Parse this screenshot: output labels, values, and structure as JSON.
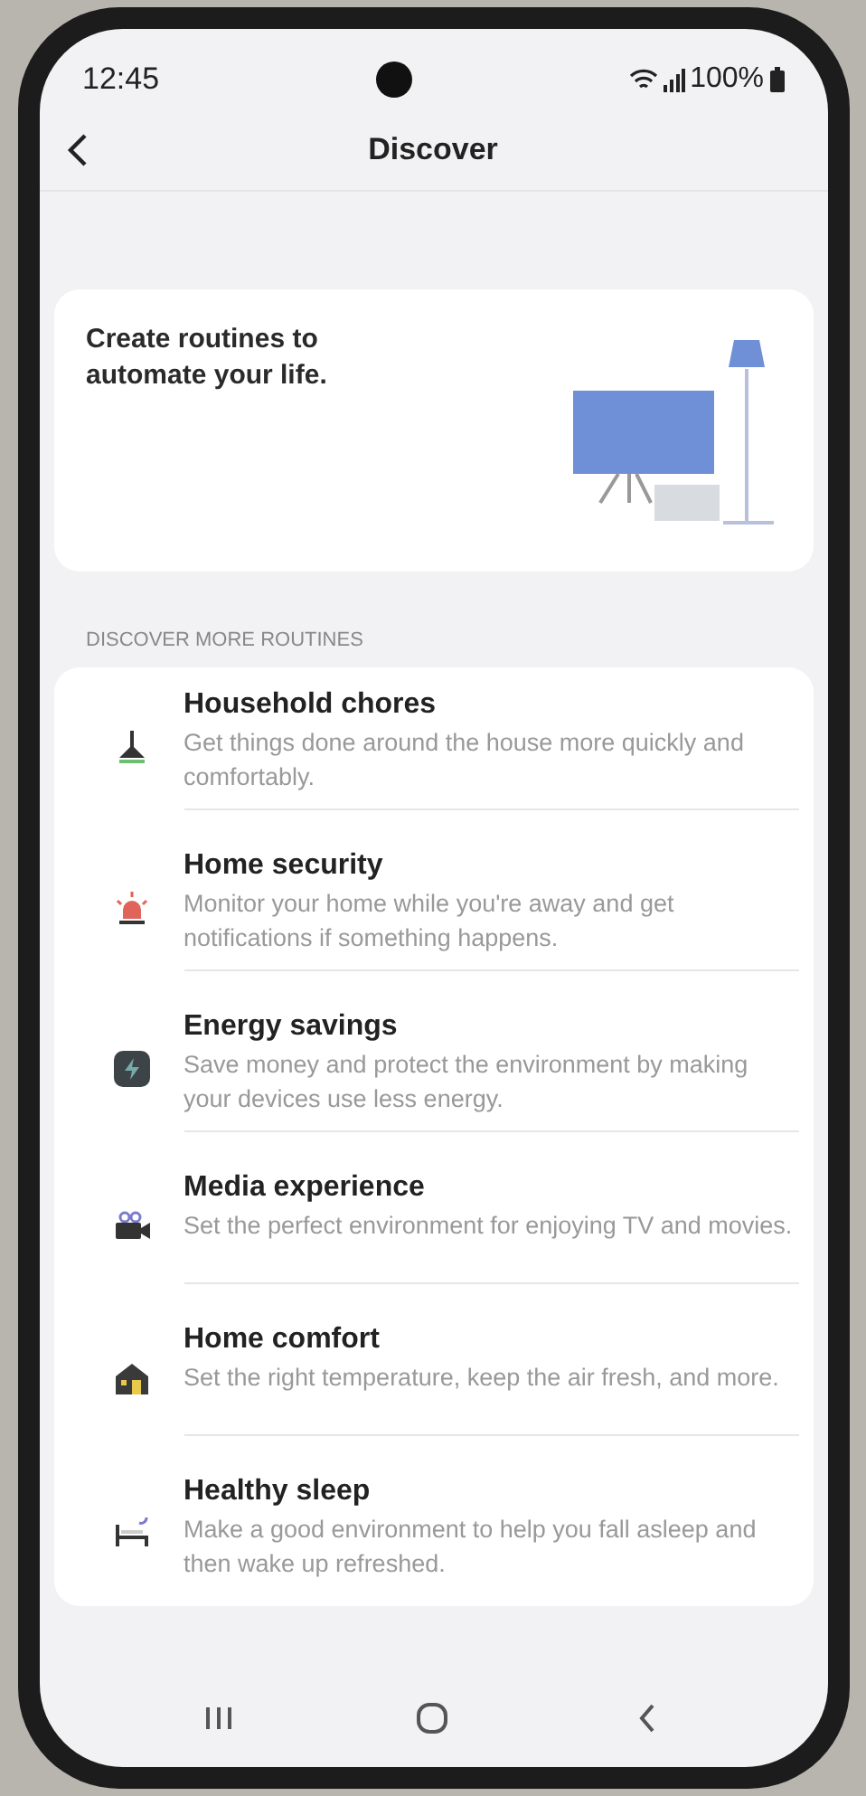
{
  "status_bar": {
    "time": "12:45",
    "battery": "100%"
  },
  "header": {
    "title": "Discover"
  },
  "banner": {
    "text": "Create routines to automate your life."
  },
  "section": {
    "label": "DISCOVER MORE ROUTINES"
  },
  "routines": [
    {
      "kind": "chores",
      "title": "Household chores",
      "description": "Get things done around the house more quickly and comfortably."
    },
    {
      "kind": "security",
      "title": "Home security",
      "description": "Monitor your home while you're away and get notifications if something happens."
    },
    {
      "kind": "energy",
      "title": "Energy savings",
      "description": "Save money and protect the environment by making your devices use less energy."
    },
    {
      "kind": "media",
      "title": "Media experience",
      "description": "Set the perfect environment for enjoying TV and movies."
    },
    {
      "kind": "comfort",
      "title": "Home comfort",
      "description": "Set the right temperature, keep the air fresh, and more."
    },
    {
      "kind": "sleep",
      "title": "Healthy sleep",
      "description": "Make a good environment to help you fall asleep and then wake up refreshed."
    }
  ]
}
